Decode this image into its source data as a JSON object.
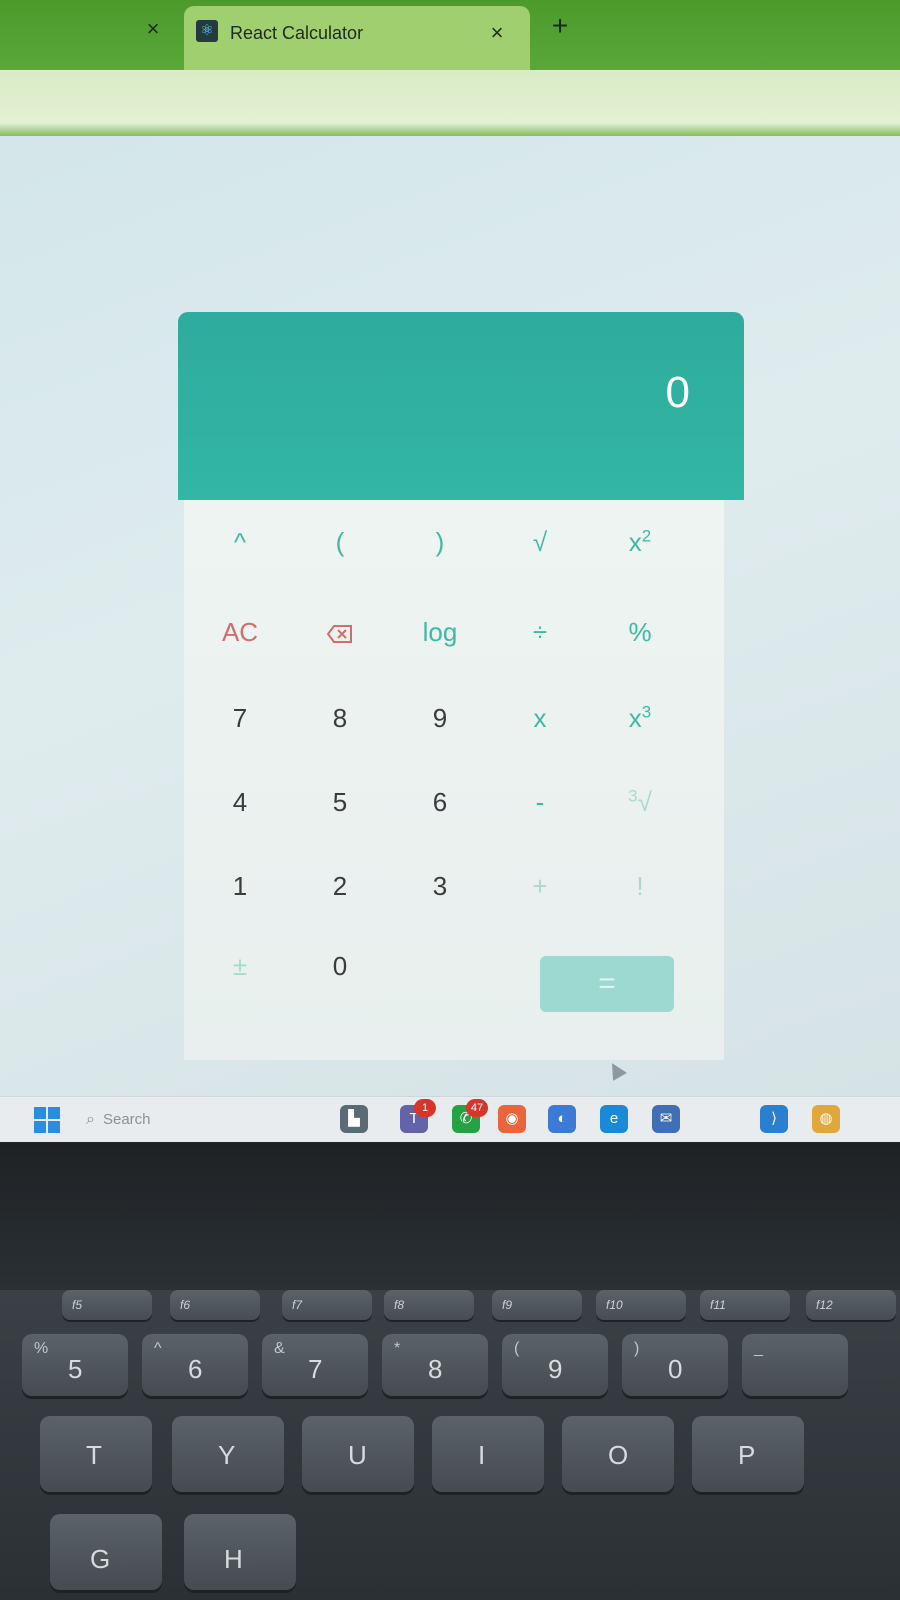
{
  "browser": {
    "active_tab_title": "React Calculator",
    "close_symbol": "×",
    "new_tab_symbol": "+",
    "favicon": "react-icon"
  },
  "calculator": {
    "display_value": "0",
    "rows": [
      [
        {
          "label": "^",
          "style": "teal"
        },
        {
          "label": "(",
          "style": "teal"
        },
        {
          "label": ")",
          "style": "teal"
        },
        {
          "label": "√",
          "style": "teal"
        },
        {
          "label": "x",
          "sup": "2",
          "style": "teal"
        }
      ],
      [
        {
          "label": "AC",
          "style": "red"
        },
        {
          "label": "⌫",
          "style": "red",
          "icon": "backspace-icon"
        },
        {
          "label": "log",
          "style": "teal"
        },
        {
          "label": "÷",
          "style": "teal"
        },
        {
          "label": "%",
          "style": "teal"
        }
      ],
      [
        {
          "label": "7",
          "style": "dark"
        },
        {
          "label": "8",
          "style": "dark"
        },
        {
          "label": "9",
          "style": "dark"
        },
        {
          "label": "x",
          "style": "teal"
        },
        {
          "label": "x",
          "sup": "3",
          "style": "teal"
        }
      ],
      [
        {
          "label": "4",
          "style": "dark"
        },
        {
          "label": "5",
          "style": "dark"
        },
        {
          "label": "6",
          "style": "dark"
        },
        {
          "label": "-",
          "style": "teal"
        },
        {
          "label": "√",
          "sup_before": "3",
          "style": "light"
        }
      ],
      [
        {
          "label": "1",
          "style": "dark"
        },
        {
          "label": "2",
          "style": "dark"
        },
        {
          "label": "3",
          "style": "dark"
        },
        {
          "label": "+",
          "style": "light"
        },
        {
          "label": "!",
          "style": "light"
        }
      ],
      [
        {
          "label": "±",
          "style": "light"
        },
        {
          "label": "0",
          "style": "dark"
        }
      ]
    ],
    "equals_label": "=",
    "colors": {
      "display": "#33b6a3",
      "teal_text": "#3fb8a6",
      "red_text": "#cf6e6a",
      "equals_bg": "#9dd9d1"
    }
  },
  "taskbar": {
    "search_placeholder": "Search",
    "icons": [
      {
        "name": "file-explorer-icon",
        "badge": ""
      },
      {
        "name": "teams-icon",
        "badge": "1"
      },
      {
        "name": "whatsapp-icon",
        "badge": "47"
      },
      {
        "name": "firefox-icon",
        "badge": ""
      },
      {
        "name": "app-icon",
        "badge": ""
      },
      {
        "name": "edge-icon",
        "badge": ""
      },
      {
        "name": "mail-icon",
        "badge": ""
      },
      {
        "name": "vscode-icon",
        "badge": ""
      },
      {
        "name": "chrome-icon",
        "badge": ""
      }
    ]
  },
  "keyboard": {
    "function_keys": [
      "f5",
      "f6",
      "f7",
      "f8",
      "f9",
      "f10",
      "f11",
      "f12"
    ],
    "number_row": [
      {
        "main": "5",
        "sub": "%"
      },
      {
        "main": "6",
        "sub": "^"
      },
      {
        "main": "7",
        "sub": "&"
      },
      {
        "main": "8",
        "sub": "*"
      },
      {
        "main": "9",
        "sub": "("
      },
      {
        "main": "0",
        "sub": ")"
      },
      {
        "main": "",
        "sub": "_"
      }
    ],
    "letter_row_1": [
      "T",
      "Y",
      "U",
      "I",
      "O",
      "P"
    ],
    "letter_row_2": [
      "G",
      "H"
    ]
  }
}
